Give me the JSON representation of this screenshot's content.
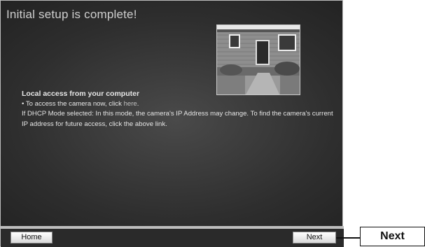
{
  "header": {
    "title": "Initial setup is complete!"
  },
  "content": {
    "heading": "Local access from your computer",
    "access_prefix": "• To access the camera now, click ",
    "access_link": "here",
    "access_suffix": ".",
    "dhcp_note": "If DHCP Mode selected: In this mode, the camera's IP Address may change. To find the camera's current IP address for future access, click the above link."
  },
  "footer": {
    "home_label": "Home",
    "next_label": "Next"
  },
  "annotation": {
    "callout_label": "Next"
  },
  "colors": {
    "panel_bg": "#2e2e2e",
    "title_text": "#cfcfcf",
    "body_text": "#e6e6e6"
  },
  "icons": {
    "photo": "house-photo"
  }
}
